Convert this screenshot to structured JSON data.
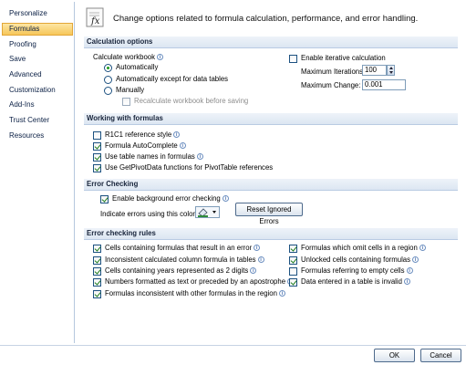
{
  "sidebar": {
    "items": [
      {
        "label": "Personalize"
      },
      {
        "label": "Formulas"
      },
      {
        "label": "Proofing"
      },
      {
        "label": "Save"
      },
      {
        "label": "Advanced"
      },
      {
        "label": "Customization"
      },
      {
        "label": "Add-Ins"
      },
      {
        "label": "Trust Center"
      },
      {
        "label": "Resources"
      }
    ],
    "selected_index": 1
  },
  "header": {
    "icon": "fx-function-icon",
    "text": "Change options related to formula calculation, performance, and error handling."
  },
  "calc": {
    "title": "Calculation options",
    "workbook_label": "Calculate workbook",
    "auto": "Automatically",
    "auto_except": "Automatically except for data tables",
    "manually": "Manually",
    "recalc_before_save": "Recalculate workbook before saving",
    "iterative": "Enable iterative calculation",
    "max_iterations_label": "Maximum Iterations:",
    "max_iterations_value": "100",
    "max_change_label": "Maximum Change:",
    "max_change_value": "0.001"
  },
  "working": {
    "title": "Working with formulas",
    "r1c1": "R1C1 reference style",
    "autocomplete": "Formula AutoComplete",
    "table_names": "Use table names in formulas",
    "getpivot": "Use GetPivotData functions for PivotTable references"
  },
  "error_checking": {
    "title": "Error Checking",
    "enable": "Enable background error checking",
    "indicate_label": "Indicate errors using this color:",
    "reset_button": "Reset Ignored Errors",
    "indicator_color": "#2e8b3a"
  },
  "rules": {
    "title": "Error checking rules",
    "left": [
      "Cells containing formulas that result in an error",
      "Inconsistent calculated column formula in tables",
      "Cells containing years represented as 2 digits",
      "Numbers formatted as text or preceded by an apostrophe",
      "Formulas inconsistent with other formulas in the region"
    ],
    "right": [
      "Formulas which omit cells in a region",
      "Unlocked cells containing formulas",
      "Formulas referring to empty cells",
      "Data entered in a table is invalid"
    ]
  },
  "buttons": {
    "ok": "OK",
    "cancel": "Cancel"
  },
  "colors": {
    "accent": "#f6c65a",
    "section": "#dce6f2",
    "border": "#b6c8de"
  }
}
